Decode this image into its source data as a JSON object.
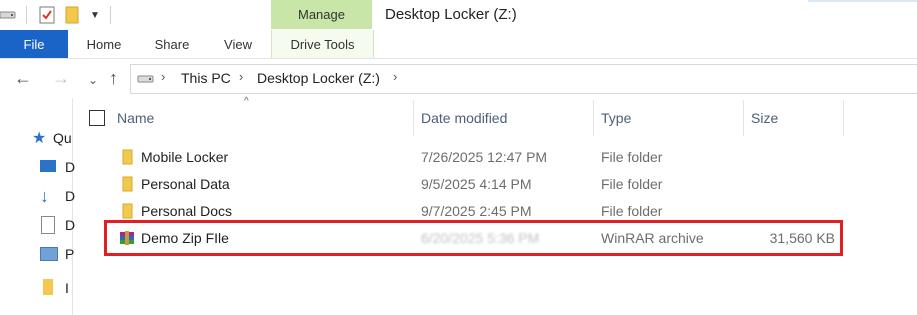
{
  "window": {
    "title": "Desktop Locker (Z:)",
    "context_tab": "Manage"
  },
  "quick_access_icons": [
    "drive-icon",
    "checkmark-properties-icon",
    "folder-icon",
    "dropdown-arrow-icon"
  ],
  "ribbon": {
    "tabs": [
      {
        "label": "File"
      },
      {
        "label": "Home"
      },
      {
        "label": "Share"
      },
      {
        "label": "View"
      },
      {
        "label": "Drive Tools"
      }
    ]
  },
  "address": {
    "crumbs": [
      "This PC",
      "Desktop Locker (Z:)"
    ]
  },
  "navpane": {
    "items": [
      {
        "icon": "star-icon",
        "label": "Qu"
      },
      {
        "icon": "desktop-icon",
        "label": "D"
      },
      {
        "icon": "download-icon",
        "label": "D"
      },
      {
        "icon": "documents-icon",
        "label": "D"
      },
      {
        "icon": "pictures-icon",
        "label": "P"
      },
      {
        "icon": "folder-icon",
        "label": "I"
      }
    ]
  },
  "columns": {
    "name": "Name",
    "date": "Date modified",
    "type": "Type",
    "size": "Size"
  },
  "files": [
    {
      "name": "Mobile Locker",
      "date": "7/26/2025 12:47 PM",
      "type": "File folder",
      "size": "",
      "icon": "folder-icon"
    },
    {
      "name": "Personal Data",
      "date": "9/5/2025 4:14 PM",
      "type": "File folder",
      "size": "",
      "icon": "folder-icon"
    },
    {
      "name": "Personal Docs",
      "date": "9/7/2025 2:45 PM",
      "type": "File folder",
      "size": "",
      "icon": "folder-icon"
    },
    {
      "name": "Demo Zip FIle",
      "date": "6/20/2025 5:36 PM",
      "type": "WinRAR archive",
      "size": "31,560 KB",
      "icon": "winrar-archive-icon"
    }
  ],
  "colors": {
    "file_tab": "#1a64c7",
    "manage_tab": "#c8e6a8",
    "highlight": "#e31e24",
    "folder": "#f2c94c"
  }
}
